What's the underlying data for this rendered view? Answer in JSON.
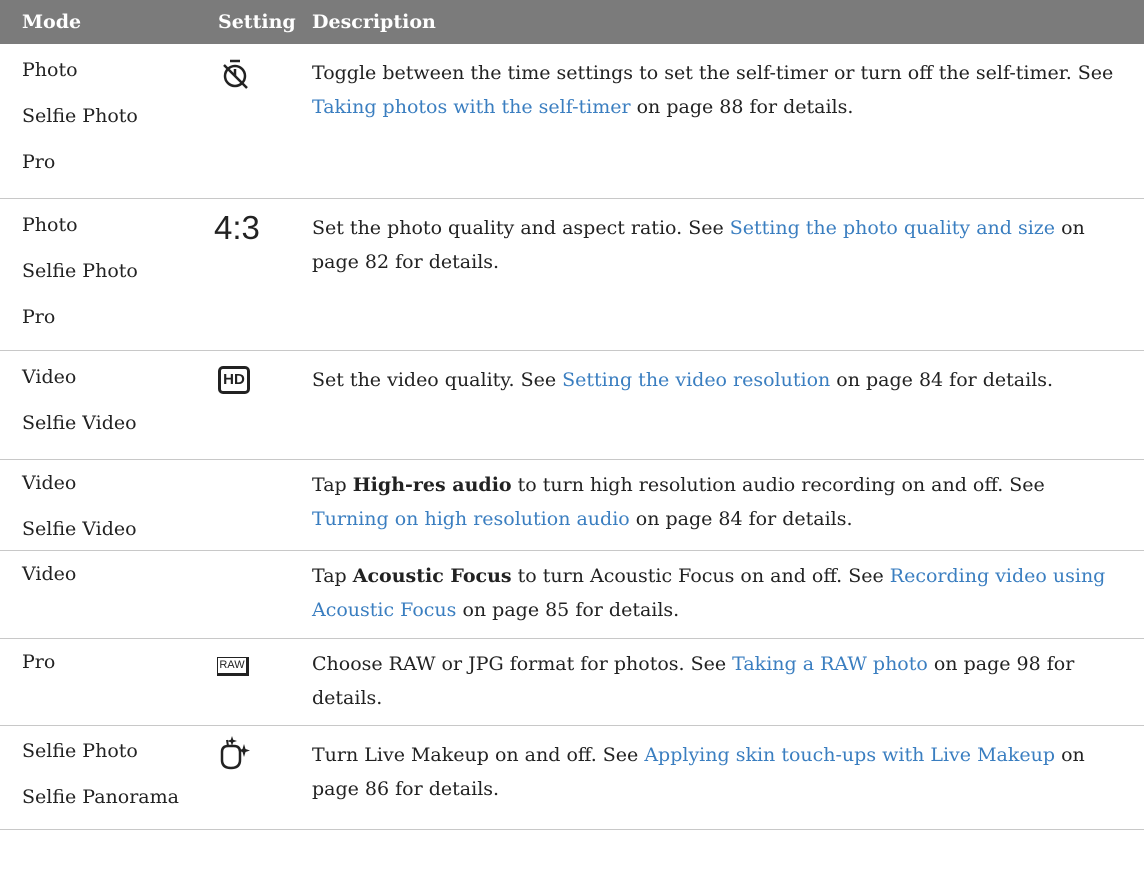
{
  "header": {
    "mode": "Mode",
    "setting": "Setting",
    "description": "Description"
  },
  "rows": [
    {
      "modes": [
        "Photo",
        "Selfie Photo",
        "Pro"
      ],
      "icon": "self-timer-icon",
      "parts": [
        {
          "t": "Toggle between the time settings to set the self-timer or turn off the self-timer. See "
        },
        {
          "t": "Taking photos with the self-timer",
          "link": true
        },
        {
          "t": " on page 88 for details."
        }
      ]
    },
    {
      "modes": [
        "Photo",
        "Selfie Photo",
        "Pro"
      ],
      "icon": "aspect-ratio-icon",
      "icon_text": "4:3",
      "parts": [
        {
          "t": "Set the photo quality and aspect ratio. See "
        },
        {
          "t": "Setting the photo quality and size",
          "link": true
        },
        {
          "t": " on page 82 for details."
        }
      ]
    },
    {
      "modes": [
        "Video",
        "Selfie Video"
      ],
      "icon": "hd-icon",
      "icon_text": "HD",
      "parts": [
        {
          "t": "Set the video quality. See "
        },
        {
          "t": "Setting the video resolution",
          "link": true
        },
        {
          "t": " on page 84 for details."
        }
      ]
    },
    {
      "modes": [
        "Video",
        "Selfie Video"
      ],
      "icon": "",
      "parts": [
        {
          "t": "Tap "
        },
        {
          "t": "High-res audio",
          "bold": true
        },
        {
          "t": " to turn high resolution audio recording on and off. See "
        },
        {
          "t": "Turning on high resolution audio",
          "link": true
        },
        {
          "t": " on page 84 for details."
        }
      ]
    },
    {
      "modes": [
        "Video"
      ],
      "icon": "",
      "parts": [
        {
          "t": "Tap "
        },
        {
          "t": "Acoustic Focus",
          "bold": true
        },
        {
          "t": " to turn Acoustic Focus on and off. See "
        },
        {
          "t": "Recording video using Acoustic Focus",
          "link": true
        },
        {
          "t": " on page 85 for details."
        }
      ]
    },
    {
      "modes": [
        "Pro"
      ],
      "icon": "raw-format-icon",
      "icon_text": "RAW",
      "parts": [
        {
          "t": "Choose RAW or JPG format for photos. See "
        },
        {
          "t": "Taking a RAW photo",
          "link": true
        },
        {
          "t": " on page 98 for details."
        }
      ]
    },
    {
      "modes": [
        "Selfie Photo",
        "Selfie Panorama"
      ],
      "icon": "live-makeup-icon",
      "parts": [
        {
          "t": "Turn Live Makeup on and off. See "
        },
        {
          "t": "Applying skin touch-ups with Live Makeup",
          "link": true
        },
        {
          "t": " on page 86 for details."
        }
      ]
    }
  ],
  "colors": {
    "header_bg": "#7b7b7b",
    "link": "#3a7ec0",
    "divider": "#c8c8c8"
  }
}
